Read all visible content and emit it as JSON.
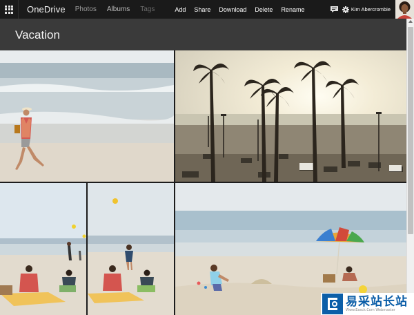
{
  "header": {
    "brand": "OneDrive",
    "nav": [
      "Photos",
      "Albums",
      "Tags"
    ],
    "commands": [
      "Add",
      "Share",
      "Download",
      "Delete",
      "Rename"
    ],
    "user_name": "Kim Abercrombie"
  },
  "album": {
    "title": "Vacation"
  },
  "photos": [
    {
      "name": "woman-walking-on-beach"
    },
    {
      "name": "palm-trees-parking-lot"
    },
    {
      "name": "people-on-beach-chairs"
    },
    {
      "name": "beach-chairs-ball"
    },
    {
      "name": "child-playing-in-sand"
    }
  ],
  "watermark": {
    "text": "易采站长站",
    "sub": "Www.Easck.Com  Webmaster"
  },
  "colors": {
    "topbar": "#1a1a1a",
    "titlebar": "#3a3a3a",
    "background": "#1c1c1c"
  }
}
